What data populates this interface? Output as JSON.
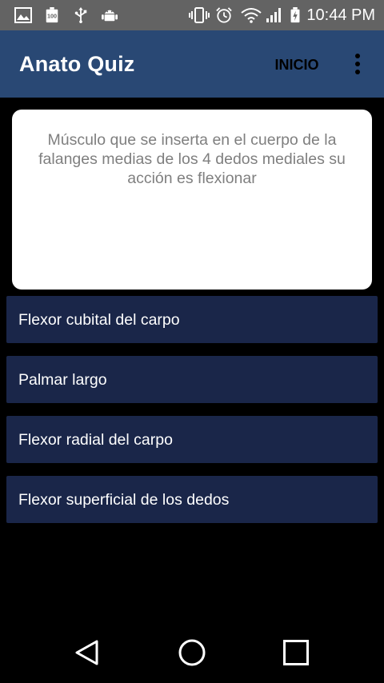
{
  "status_bar": {
    "time": "10:44 PM",
    "left_icons": [
      "image-icon",
      "battery-100-icon",
      "usb-icon",
      "android-icon"
    ],
    "right_icons": [
      "vibrate-icon",
      "alarm-icon",
      "wifi-icon",
      "signal-icon",
      "battery-charging-icon"
    ]
  },
  "app_bar": {
    "title": "Anato Quiz",
    "inicio_label": "INICIO",
    "menu_icon": "more-vert-icon"
  },
  "question": {
    "text": "Músculo que se inserta en el cuerpo de la falanges medias de los 4 dedos mediales su acción es flexionar"
  },
  "answers": [
    {
      "label": "Flexor cubital del carpo"
    },
    {
      "label": "Palmar largo"
    },
    {
      "label": "Flexor radial del carpo"
    },
    {
      "label": "Flexor superficial de los dedos"
    }
  ],
  "nav_bar": {
    "back_icon": "back-triangle-icon",
    "home_icon": "home-circle-icon",
    "recents_icon": "recents-square-icon"
  },
  "colors": {
    "status_bar": "#636363",
    "app_bar": "#294874",
    "answer_bg": "#1a2649",
    "question_text": "#7f7f7f",
    "background": "#000000"
  }
}
